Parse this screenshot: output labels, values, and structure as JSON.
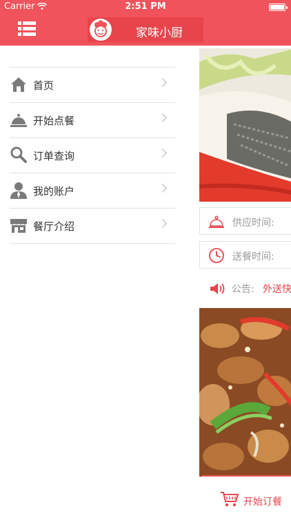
{
  "status_bar": {
    "carrier": "Carrier",
    "time": "2:51 PM"
  },
  "navbar": {
    "title": "家味小厨"
  },
  "menu": {
    "items": [
      {
        "label": "首页",
        "icon": "home-icon"
      },
      {
        "label": "开始点餐",
        "icon": "cloche-icon"
      },
      {
        "label": "订单查询",
        "icon": "search-icon"
      },
      {
        "label": "我的账户",
        "icon": "user-icon"
      },
      {
        "label": "餐厅介绍",
        "icon": "storefront-icon"
      }
    ]
  },
  "main": {
    "supply_time_label": "供应时间:",
    "delivery_time_label": "送餐时间:",
    "notice_label": "公告:",
    "notice_text": "外送快",
    "order_button_label": "开始订餐"
  },
  "colors": {
    "brand": "#f0535b",
    "accent_text": "#e8444c",
    "muted_text": "#9a9a9a",
    "icon_gray": "#7a7a7a"
  }
}
